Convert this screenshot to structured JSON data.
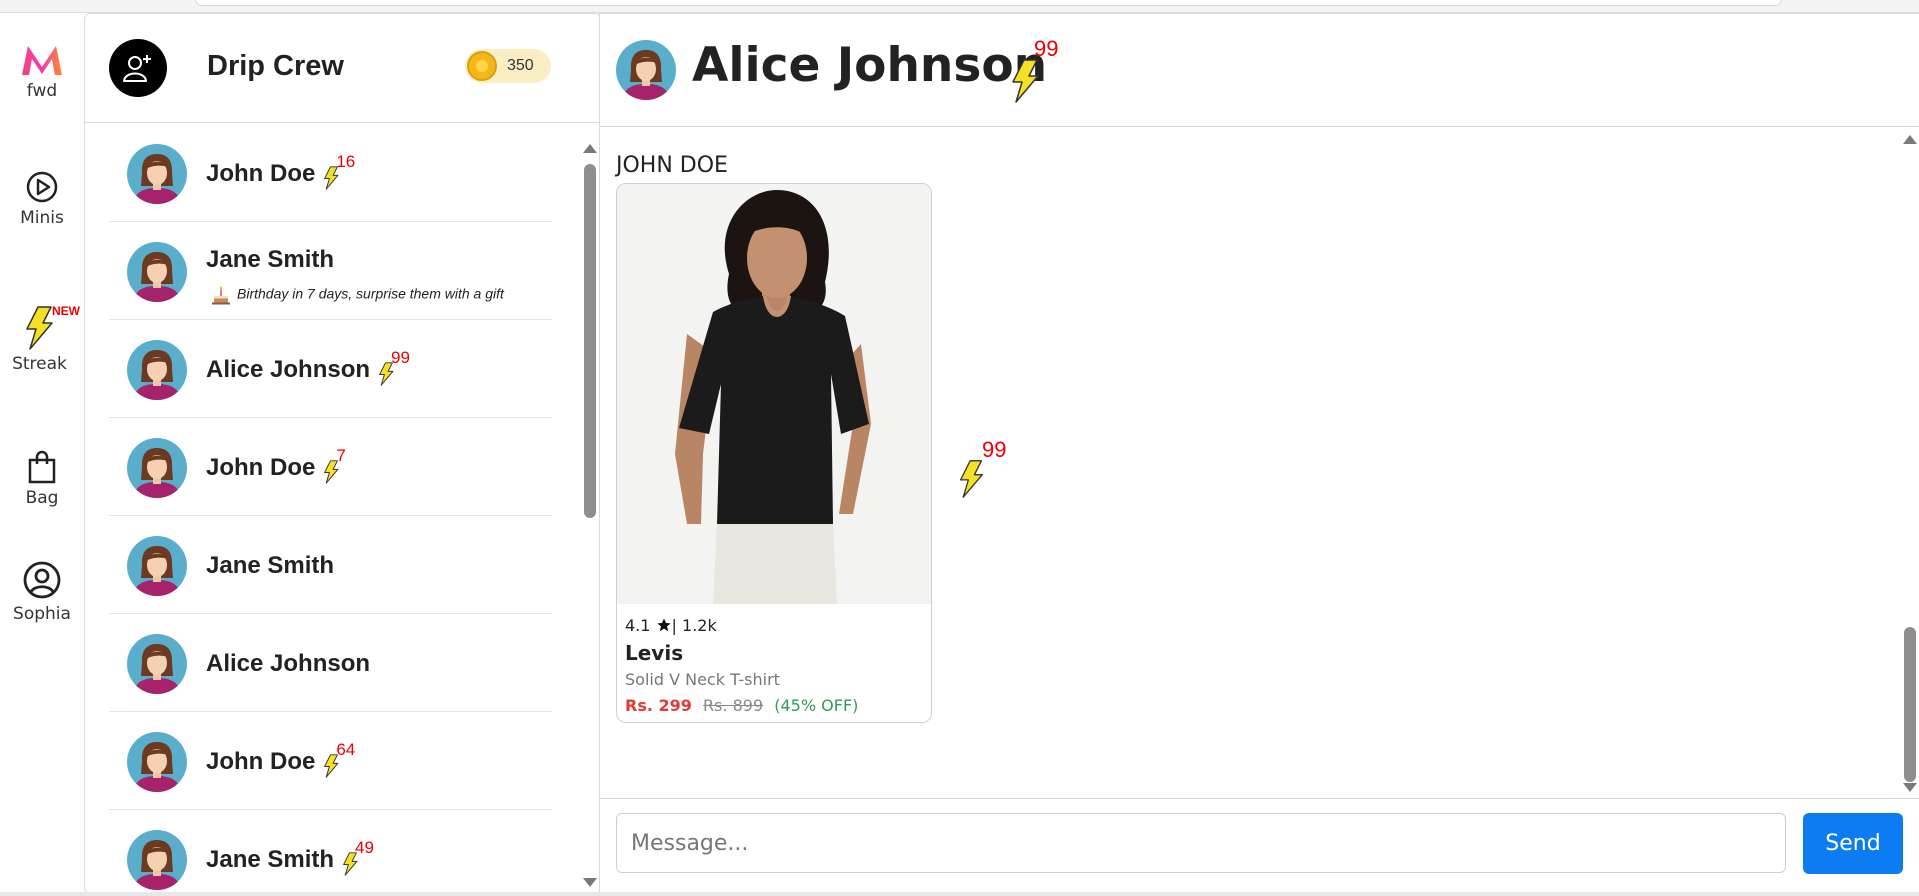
{
  "rail": {
    "items": [
      {
        "label": "fwd",
        "icon": "myntra-logo-icon"
      },
      {
        "label": "Minis",
        "icon": "play-circle-icon"
      },
      {
        "label": "Streak",
        "icon": "lightning-icon",
        "badge": "NEW"
      },
      {
        "label": "Bag",
        "icon": "shopping-bag-icon"
      },
      {
        "label": "Sophia",
        "icon": "user-circle-icon"
      }
    ]
  },
  "group": {
    "name": "Drip Crew",
    "add_icon": "add-user-icon",
    "coins": "350"
  },
  "contacts": [
    {
      "name": "John Doe",
      "streak": "16"
    },
    {
      "name": "Jane Smith",
      "subtitle": "Birthday in 7 days, surprise them with a gift"
    },
    {
      "name": "Alice Johnson",
      "streak": "99"
    },
    {
      "name": "John Doe",
      "streak": "7"
    },
    {
      "name": "Jane Smith"
    },
    {
      "name": "Alice Johnson"
    },
    {
      "name": "John Doe",
      "streak": "64"
    },
    {
      "name": "Jane Smith",
      "streak": "49"
    }
  ],
  "chat": {
    "name": "Alice Johnson",
    "streak": "99",
    "sender": "JOHN DOE",
    "message_streak": "99",
    "product": {
      "rating": "4.1",
      "reviews": "| 1.2k",
      "brand": "Levis",
      "description": "Solid V Neck T-shirt",
      "price": "Rs. 299",
      "mrp": "Rs. 899",
      "discount": "(45% OFF)"
    },
    "input_placeholder": "Message...",
    "input_value": "",
    "send_label": "Send"
  },
  "colors": {
    "accent": "#0d7cf2",
    "streak_number": "#ee0000",
    "lightning": "#f6e025",
    "price": "#e53935",
    "discount": "#2e9e56",
    "avatar_bg": "#5aaecb"
  }
}
